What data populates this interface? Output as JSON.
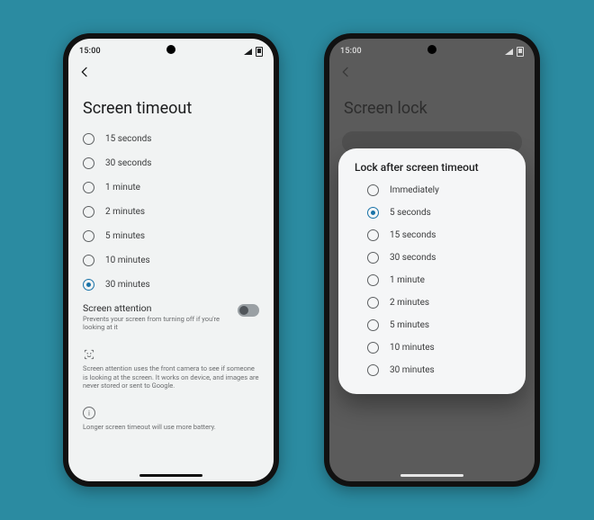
{
  "status": {
    "time": "15:00"
  },
  "left": {
    "title": "Screen timeout",
    "options": [
      {
        "label": "15 seconds",
        "selected": false
      },
      {
        "label": "30 seconds",
        "selected": false
      },
      {
        "label": "1 minute",
        "selected": false
      },
      {
        "label": "2 minutes",
        "selected": false
      },
      {
        "label": "5 minutes",
        "selected": false
      },
      {
        "label": "10 minutes",
        "selected": false
      },
      {
        "label": "30 minutes",
        "selected": true
      }
    ],
    "screen_attention": {
      "title": "Screen attention",
      "subtitle": "Prevents your screen from turning off if you're looking at it",
      "on": false
    },
    "attention_info": "Screen attention uses the front camera to see if someone is looking at the screen. It works on device, and images are never stored or sent to Google.",
    "battery_info": "Longer screen timeout will use more battery."
  },
  "right": {
    "title": "Screen lock",
    "dialog": {
      "title": "Lock after screen timeout",
      "options": [
        {
          "label": "Immediately",
          "selected": false
        },
        {
          "label": "5 seconds",
          "selected": true
        },
        {
          "label": "15 seconds",
          "selected": false
        },
        {
          "label": "30 seconds",
          "selected": false
        },
        {
          "label": "1 minute",
          "selected": false
        },
        {
          "label": "2 minutes",
          "selected": false
        },
        {
          "label": "5 minutes",
          "selected": false
        },
        {
          "label": "10 minutes",
          "selected": false
        },
        {
          "label": "30 minutes",
          "selected": false
        }
      ]
    }
  }
}
